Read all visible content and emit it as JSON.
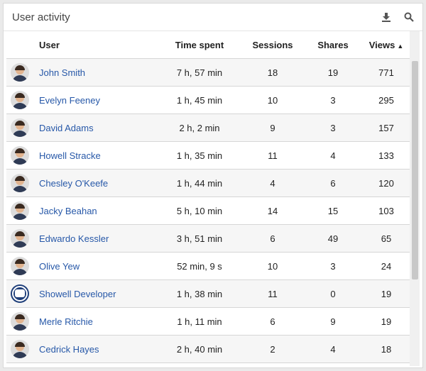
{
  "header": {
    "title": "User activity",
    "download_icon": "download-icon",
    "search_icon": "search-icon"
  },
  "columns": {
    "user": "User",
    "time": "Time spent",
    "sessions": "Sessions",
    "shares": "Shares",
    "views": "Views",
    "sort_indicator": "▲"
  },
  "rows": [
    {
      "name": "John Smith",
      "time": "7 h, 57 min",
      "sessions": "18",
      "shares": "19",
      "views": "771"
    },
    {
      "name": "Evelyn Feeney",
      "time": "1 h, 45 min",
      "sessions": "10",
      "shares": "3",
      "views": "295"
    },
    {
      "name": "David Adams",
      "time": "2 h, 2 min",
      "sessions": "9",
      "shares": "3",
      "views": "157"
    },
    {
      "name": "Howell Stracke",
      "time": "1 h, 35 min",
      "sessions": "11",
      "shares": "4",
      "views": "133"
    },
    {
      "name": "Chesley O'Keefe",
      "time": "1 h, 44 min",
      "sessions": "4",
      "shares": "6",
      "views": "120"
    },
    {
      "name": "Jacky Beahan",
      "time": "5 h, 10 min",
      "sessions": "14",
      "shares": "15",
      "views": "103"
    },
    {
      "name": "Edwardo Kessler",
      "time": "3 h, 51 min",
      "sessions": "6",
      "shares": "49",
      "views": "65"
    },
    {
      "name": "Olive Yew",
      "time": "52 min, 9 s",
      "sessions": "10",
      "shares": "3",
      "views": "24"
    },
    {
      "name": "Showell Developer",
      "time": "1 h, 38 min",
      "sessions": "11",
      "shares": "0",
      "views": "19"
    },
    {
      "name": "Merle Ritchie",
      "time": "1 h, 11 min",
      "sessions": "6",
      "shares": "9",
      "views": "19"
    },
    {
      "name": "Cedrick Hayes",
      "time": "2 h, 40 min",
      "sessions": "2",
      "shares": "4",
      "views": "18"
    }
  ]
}
